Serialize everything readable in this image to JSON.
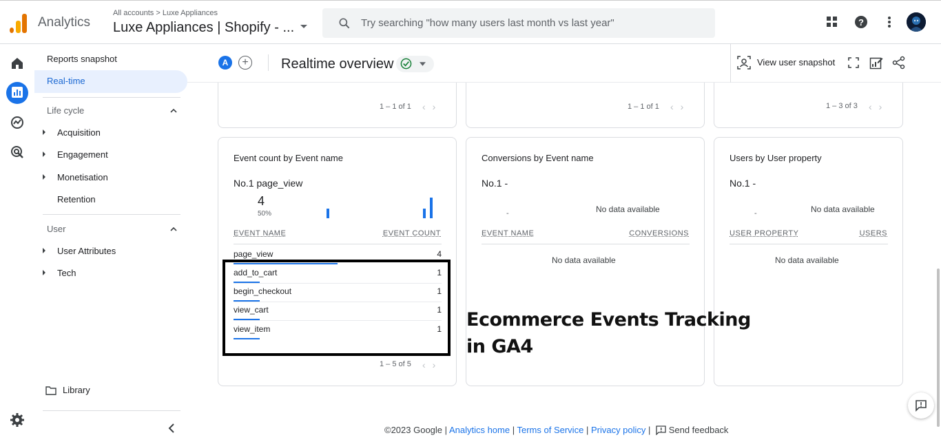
{
  "topbar": {
    "brand": "Analytics",
    "breadcrumb": "All accounts > Luxe Appliances",
    "property": "Luxe Appliances | Shopify - ...",
    "search_placeholder": "Try searching \"how many users last month vs last year\""
  },
  "nav": {
    "reports_snapshot": "Reports snapshot",
    "realtime": "Real-time",
    "lifecycle": "Life cycle",
    "acquisition": "Acquisition",
    "engagement": "Engagement",
    "monetisation": "Monetisation",
    "retention": "Retention",
    "user": "User",
    "user_attributes": "User Attributes",
    "tech": "Tech",
    "library": "Library"
  },
  "header": {
    "avatar_letter": "A",
    "plus": "+",
    "title": "Realtime overview",
    "view_user_snapshot": "View user snapshot"
  },
  "top_cards": {
    "pager1": "1 – 1 of 1",
    "pager2": "1 – 1 of 1",
    "pager3": "1 – 3 of 3"
  },
  "event_card": {
    "title": "Event count by Event name",
    "no1": "No.1",
    "top_event": "page_view",
    "top_value": "4",
    "top_percent": "50%",
    "col_event": "EVENT NAME",
    "col_count": "EVENT COUNT",
    "rows": [
      {
        "name": "page_view",
        "count": "4"
      },
      {
        "name": "add_to_cart",
        "count": "1"
      },
      {
        "name": "begin_checkout",
        "count": "1"
      },
      {
        "name": "view_cart",
        "count": "1"
      },
      {
        "name": "view_item",
        "count": "1"
      }
    ],
    "pager": "1 – 5 of 5"
  },
  "conversions_card": {
    "title": "Conversions by Event name",
    "no1": "No.1  -",
    "dash": "-",
    "nodata_chart": "No data available",
    "col_event": "EVENT NAME",
    "col_conv": "CONVERSIONS",
    "nodata_table": "No data available"
  },
  "users_card": {
    "title": "Users by User property",
    "no1": "No.1  -",
    "dash": "-",
    "nodata_chart": "No data available",
    "col_prop": "USER PROPERTY",
    "col_users": "USERS",
    "nodata_table": "No data available"
  },
  "overlay": {
    "text": "Ecommerce Events Tracking in GA4"
  },
  "footer": {
    "copyright": "©2023 Google |",
    "analytics_home": "Analytics home",
    "terms": "Terms of Service",
    "privacy": "Privacy policy",
    "send_feedback": "Send feedback",
    "sep": "|"
  },
  "colors": {
    "accent": "#1a73e8",
    "logo_orange": "#e37400",
    "logo_yellow": "#f9ab00",
    "active_nav_bg": "#e8f0fe",
    "check_green": "#188038"
  }
}
